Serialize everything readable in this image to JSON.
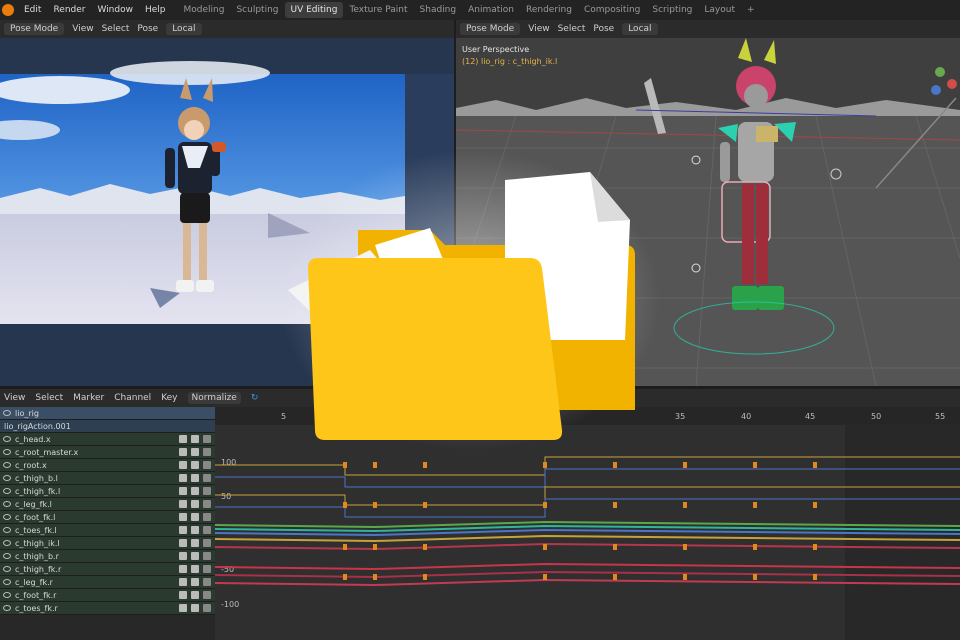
{
  "menu": [
    "Edit",
    "Render",
    "Window",
    "Help"
  ],
  "workspaces": [
    "Modeling",
    "Sculpting",
    "UV Editing",
    "Texture Paint",
    "Shading",
    "Animation",
    "Rendering",
    "Compositing",
    "Scripting",
    "Layout"
  ],
  "active_workspace": "UV Editing",
  "left_header": {
    "mode": "Pose Mode",
    "items": [
      "View",
      "Select",
      "Pose"
    ],
    "orientation": "Local"
  },
  "right_header": {
    "mode": "Pose Mode",
    "items": [
      "View",
      "Select",
      "Pose"
    ],
    "orientation": "Local"
  },
  "right_viewport": {
    "title": "User Perspective",
    "subtitle": "(12) lio_rig : c_thigh_ik.l"
  },
  "graph_header": {
    "items": [
      "View",
      "Select",
      "Marker",
      "Channel",
      "Key"
    ],
    "normalize": "Normalize"
  },
  "timeline": {
    "frames": [
      "5",
      "35",
      "40",
      "45",
      "50",
      "55"
    ]
  },
  "y_axis": [
    "100",
    "50",
    "-50",
    "-100"
  ],
  "channels": {
    "object": "lio_rig",
    "action": "lio_rigAction.001",
    "groups": [
      "c_head.x",
      "c_root_master.x",
      "c_root.x",
      "c_thigh_b.l",
      "c_thigh_fk.l",
      "c_leg_fk.l",
      "c_foot_fk.l",
      "c_toes_fk.l",
      "c_thigh_ik.l",
      "c_thigh_b.r",
      "c_thigh_fk.r",
      "c_leg_fk.r",
      "c_foot_fk.r",
      "c_toes_fk.r"
    ]
  },
  "colors": {
    "accent": "#e87d0d",
    "folder": "#ffc61a",
    "folder_back": "#f5b400",
    "selected_bone": "#2ad0b0"
  }
}
